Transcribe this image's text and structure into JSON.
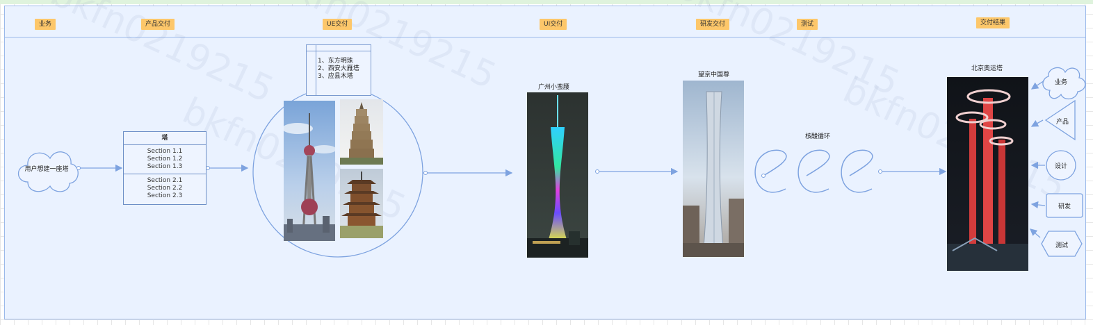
{
  "columns": {
    "business": "业务",
    "product": "产品交付",
    "ue": "UE交付",
    "ui": "UI交付",
    "dev": "研发交付",
    "test": "测试",
    "result": "交付结果"
  },
  "start": {
    "label": "用户想建一座塔"
  },
  "tower_table": {
    "title": "塔",
    "section1": [
      "Section 1.1",
      "Section 1.2",
      "Section 1.3"
    ],
    "section2": [
      "Section 2.1",
      "Section 2.2",
      "Section 2.3"
    ]
  },
  "ue_list": [
    "1、东方明珠",
    "2、西安大雁塔",
    "3、应县木塔"
  ],
  "photos": {
    "guangzhou": "广州小蛮腰",
    "citic": "望京中国尊",
    "beijing": "北京奥运塔"
  },
  "loop_label": "核酸循环",
  "feedback": [
    "业务",
    "产品",
    "设计",
    "研发",
    "测试"
  ],
  "watermark": "bkfn0219215",
  "colors": {
    "tag": "#fdc76a",
    "frame": "#9bb9ea",
    "background": "#eaf2ff"
  }
}
